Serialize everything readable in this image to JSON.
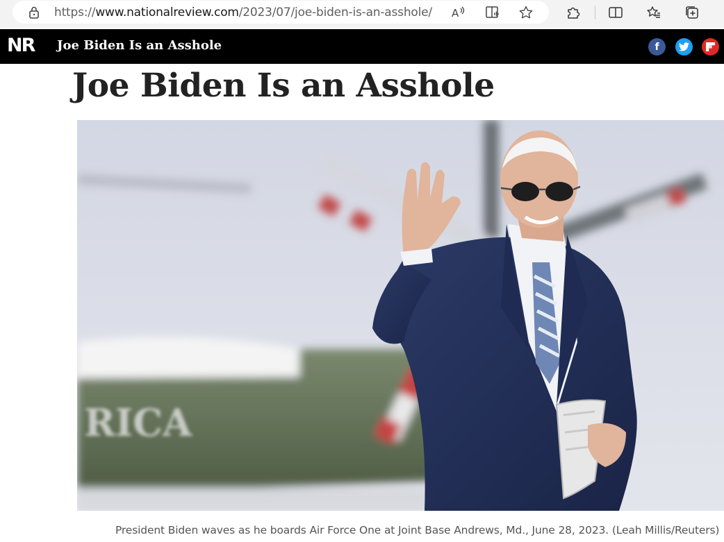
{
  "browser": {
    "url_prefix": "https://",
    "url_domain": "www.nationalreview.com",
    "url_path": "/2023/07/joe-biden-is-an-asshole/",
    "icons": [
      "lock-icon",
      "read-aloud-icon",
      "immersive-reader-icon",
      "favorite-star-icon",
      "extensions-icon",
      "split-screen-icon",
      "favorites-icon",
      "collections-icon"
    ]
  },
  "site": {
    "logo": "NR",
    "header_title": "Joe Biden Is an Asshole",
    "social": [
      {
        "name": "facebook",
        "glyph": "f",
        "color": "#3b5998"
      },
      {
        "name": "twitter",
        "color": "#1da1f2"
      },
      {
        "name": "flipboard",
        "color": "#e12828"
      }
    ]
  },
  "article": {
    "title": "Joe Biden Is an Asshole",
    "image_text": "RICA",
    "caption": "President Biden waves as he boards Air Force One at Joint Base Andrews, Md., June 28, 2023. (Leah Millis/Reuters)"
  }
}
